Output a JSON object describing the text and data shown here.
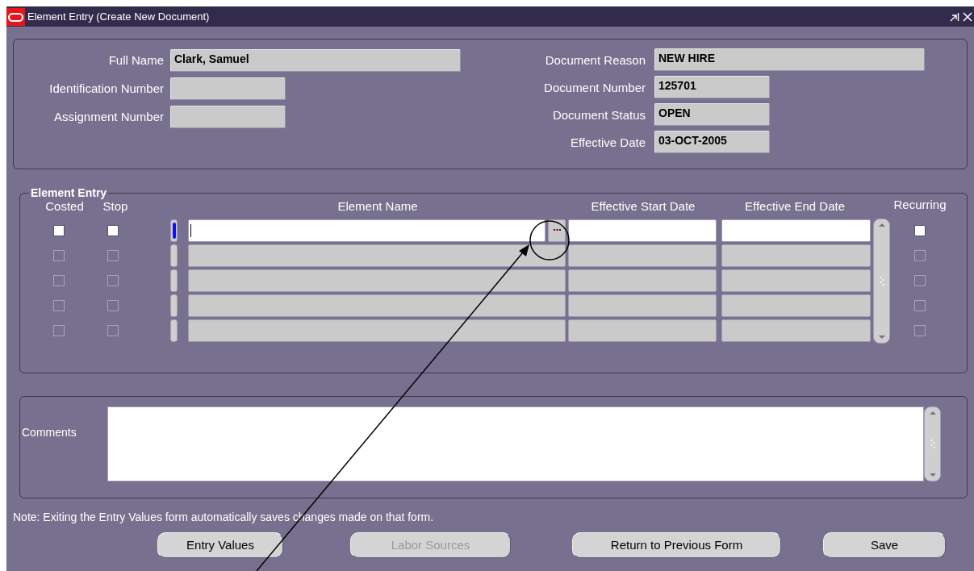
{
  "window": {
    "title": "Element Entry (Create New Document)"
  },
  "header": {
    "left": [
      {
        "label": "Full Name",
        "value": "Clark, Samuel"
      },
      {
        "label": "Identification Number"
      },
      {
        "label": "Assignment Number"
      }
    ],
    "right": [
      {
        "label": "Document Reason",
        "value": "NEW HIRE"
      },
      {
        "label": "Document Number",
        "value": "125701"
      },
      {
        "label": "Document Status",
        "value": "OPEN"
      },
      {
        "label": "Effective Date",
        "value": "03-OCT-2005"
      }
    ]
  },
  "element_entry": {
    "legend": "Element Entry",
    "columns": [
      "Costed",
      "Stop",
      "Element Name",
      "Effective Start Date",
      "Effective End Date",
      "Recurring"
    ],
    "rows": [
      {
        "selected": true,
        "costed": false,
        "stop": false,
        "recurring": false
      },
      {
        "selected": false,
        "costed": false,
        "stop": false,
        "recurring": false
      },
      {
        "selected": false,
        "costed": false,
        "stop": false,
        "recurring": false
      },
      {
        "selected": false,
        "costed": false,
        "stop": false,
        "recurring": false
      },
      {
        "selected": false,
        "costed": false,
        "stop": false,
        "recurring": false
      }
    ]
  },
  "comments": {
    "label": "Comments"
  },
  "note": "Note: Exiting the Entry Values form automatically saves changes made on that form.",
  "buttons": [
    {
      "label": "Entry Values",
      "disabled": false
    },
    {
      "label": "Labor Sources",
      "disabled": true
    },
    {
      "label": "Return to Previous Form",
      "disabled": false
    },
    {
      "label": "Save",
      "disabled": false
    }
  ]
}
